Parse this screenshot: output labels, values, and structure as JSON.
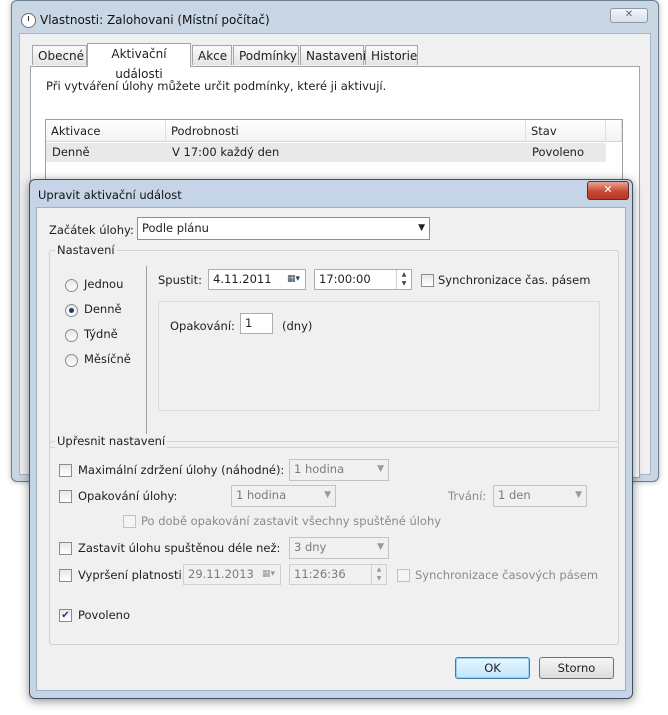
{
  "background_window": {
    "title": "Vlastnosti: Zalohovani (Místní počítač)",
    "close": "✕",
    "tabs": [
      {
        "label": "Obecné"
      },
      {
        "label": "Aktivační události"
      },
      {
        "label": "Akce"
      },
      {
        "label": "Podmínky"
      },
      {
        "label": "Nastavení"
      },
      {
        "label": "Historie"
      }
    ],
    "description": "Při vytváření úlohy můžete určit podmínky, které ji aktivují.",
    "grid": {
      "columns": [
        "Aktivace",
        "Podrobnosti",
        "Stav"
      ],
      "rows": [
        [
          "Denně",
          "V 17:00 každý den",
          "Povoleno"
        ]
      ]
    }
  },
  "dialog": {
    "title": "Upravit aktivační událost",
    "close": "✕",
    "start": {
      "label": "Začátek úlohy:",
      "value": "Podle plánu"
    },
    "settings": {
      "legend": "Nastavení",
      "radios": [
        {
          "label": "Jednou",
          "selected": false
        },
        {
          "label": "Denně",
          "selected": true
        },
        {
          "label": "Týdně",
          "selected": false
        },
        {
          "label": "Měsíčně",
          "selected": false
        }
      ],
      "start_label": "Spustit:",
      "start_date": "4.11.2011",
      "start_time": "17:00:00",
      "sync_label": "Synchronizace čas. pásem",
      "repeat_label": "Opakování:",
      "repeat_value": "1",
      "repeat_unit": "(dny)"
    },
    "advanced": {
      "legend": "Upřesnit nastavení",
      "max_delay": {
        "label": "Maximální zdržení úlohy (náhodné):",
        "value": "1 hodina"
      },
      "repeat": {
        "label": "Opakování úlohy:",
        "value": "1 hodina",
        "duration_label": "Trvání:",
        "duration_value": "1 den"
      },
      "stop_all": {
        "label": "Po době opakování zastavit všechny spuštěné úlohy"
      },
      "stop_longer": {
        "label": "Zastavit úlohu spuštěnou déle než:",
        "value": "3 dny"
      },
      "expire": {
        "label": "Vypršení platnosti:",
        "date": "29.11.2013",
        "time": "11:26:36",
        "sync_label": "Synchronizace časových pásem"
      },
      "enabled": {
        "label": "Povoleno",
        "checked": true
      }
    },
    "buttons": {
      "ok": "OK",
      "cancel": "Storno"
    }
  }
}
